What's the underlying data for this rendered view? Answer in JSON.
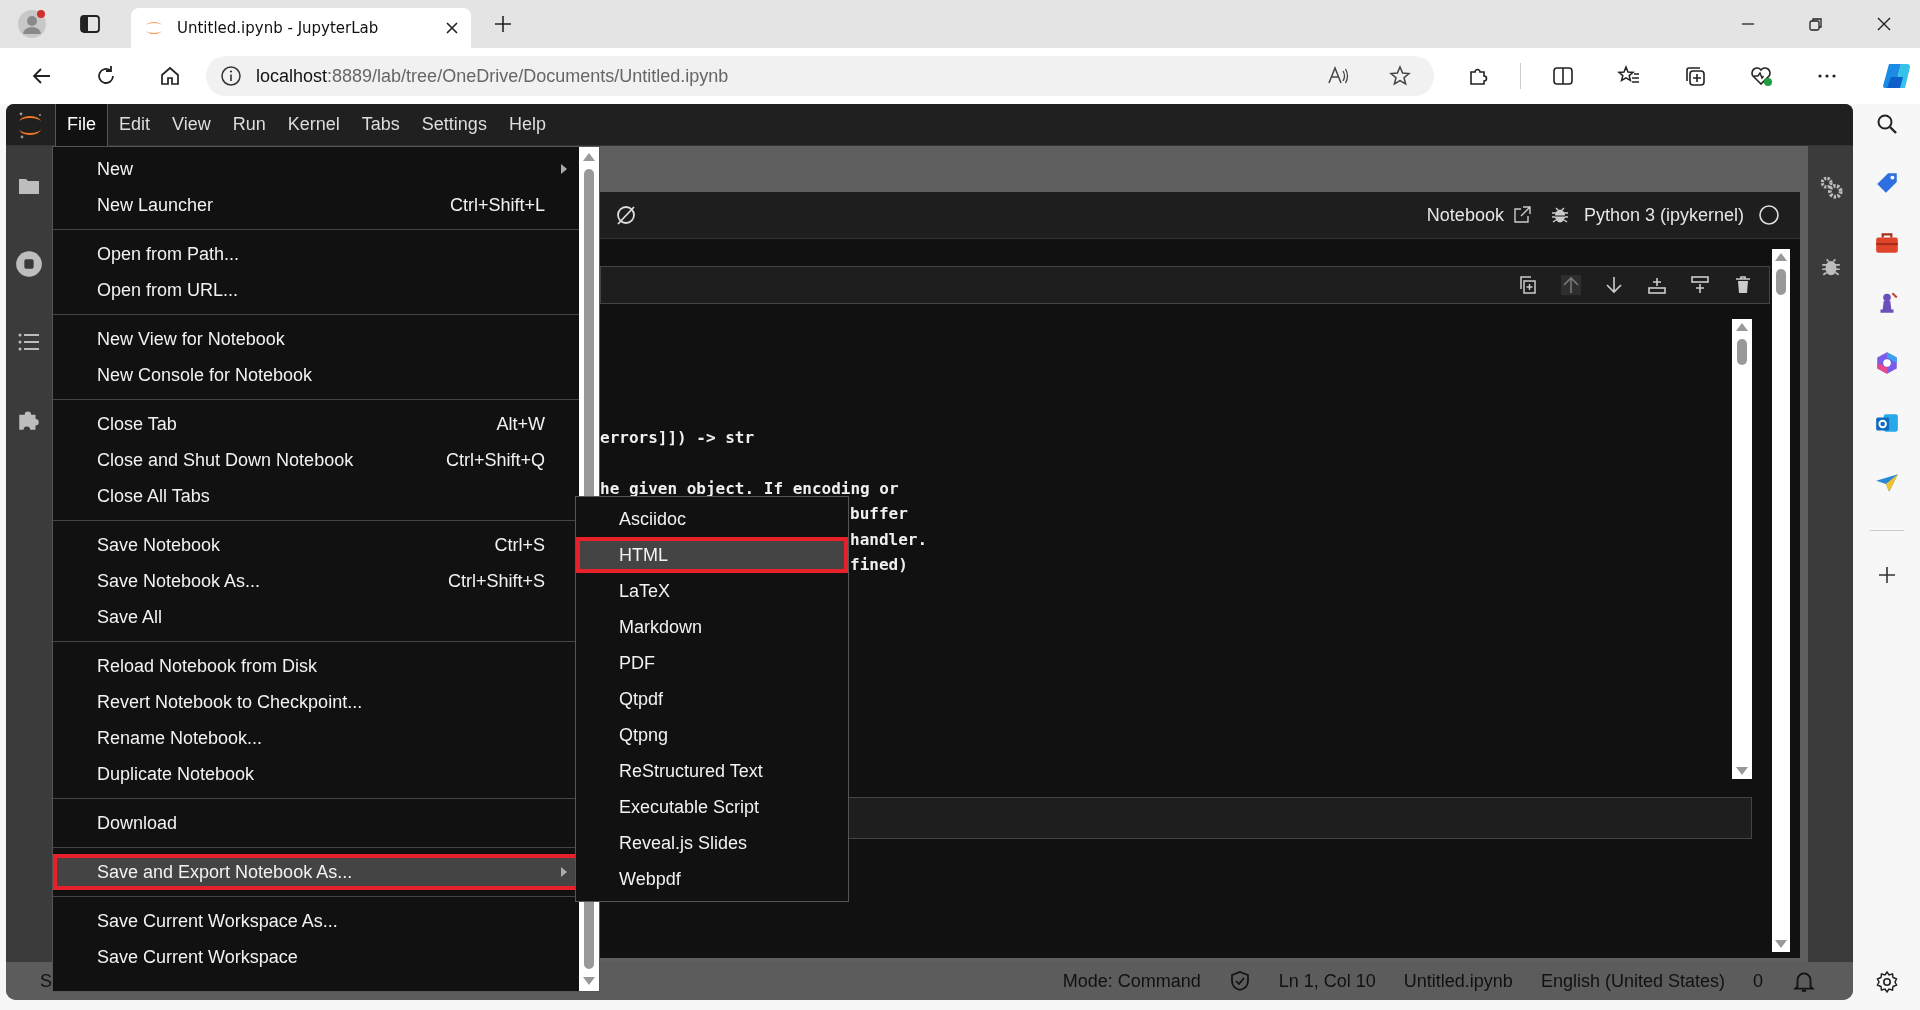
{
  "browser": {
    "tab_title": "Untitled.ipynb - JupyterLab",
    "url_host": "localhost",
    "url_rest": ":8889/lab/tree/OneDrive/Documents/Untitled.ipynb"
  },
  "menubar": [
    {
      "label": "File",
      "selected": true
    },
    {
      "label": "Edit",
      "selected": false
    },
    {
      "label": "View",
      "selected": false
    },
    {
      "label": "Run",
      "selected": false
    },
    {
      "label": "Kernel",
      "selected": false
    },
    {
      "label": "Tabs",
      "selected": false
    },
    {
      "label": "Settings",
      "selected": false
    },
    {
      "label": "Help",
      "selected": false
    }
  ],
  "file_menu": [
    [
      {
        "label": "New",
        "has_submenu": true,
        "selected": false
      },
      {
        "label": "New Launcher",
        "shortcut": "Ctrl+Shift+L",
        "has_submenu": false,
        "selected": false
      }
    ],
    [
      {
        "label": "Open from Path...",
        "has_submenu": false,
        "selected": false
      },
      {
        "label": "Open from URL...",
        "has_submenu": false,
        "selected": false
      }
    ],
    [
      {
        "label": "New View for Notebook",
        "has_submenu": false,
        "selected": false
      },
      {
        "label": "New Console for Notebook",
        "has_submenu": false,
        "selected": false
      }
    ],
    [
      {
        "label": "Close Tab",
        "shortcut": "Alt+W",
        "has_submenu": false,
        "selected": false
      },
      {
        "label": "Close and Shut Down Notebook",
        "shortcut": "Ctrl+Shift+Q",
        "has_submenu": false,
        "selected": false
      },
      {
        "label": "Close All Tabs",
        "has_submenu": false,
        "selected": false
      }
    ],
    [
      {
        "label": "Save Notebook",
        "shortcut": "Ctrl+S",
        "has_submenu": false,
        "selected": false
      },
      {
        "label": "Save Notebook As...",
        "shortcut": "Ctrl+Shift+S",
        "has_submenu": false,
        "selected": false
      },
      {
        "label": "Save All",
        "has_submenu": false,
        "selected": false
      }
    ],
    [
      {
        "label": "Reload Notebook from Disk",
        "has_submenu": false,
        "selected": false
      },
      {
        "label": "Revert Notebook to Checkpoint...",
        "has_submenu": false,
        "selected": false
      },
      {
        "label": "Rename Notebook...",
        "has_submenu": false,
        "selected": false
      },
      {
        "label": "Duplicate Notebook",
        "has_submenu": false,
        "selected": false
      }
    ],
    [
      {
        "label": "Download",
        "has_submenu": false,
        "selected": false
      }
    ],
    [
      {
        "label": "Save and Export Notebook As...",
        "has_submenu": true,
        "selected": true
      }
    ],
    [
      {
        "label": "Save Current Workspace As...",
        "has_submenu": false,
        "selected": false
      },
      {
        "label": "Save Current Workspace",
        "has_submenu": false,
        "selected": false
      }
    ]
  ],
  "export_submenu": [
    {
      "label": "Asciidoc",
      "selected": false
    },
    {
      "label": "HTML",
      "selected": true
    },
    {
      "label": "LaTeX",
      "selected": false
    },
    {
      "label": "Markdown",
      "selected": false
    },
    {
      "label": "PDF",
      "selected": false
    },
    {
      "label": "Qtpdf",
      "selected": false
    },
    {
      "label": "Qtpng",
      "selected": false
    },
    {
      "label": "ReStructured Text",
      "selected": false
    },
    {
      "label": "Executable Script",
      "selected": false
    },
    {
      "label": "Reveal.js Slides",
      "selected": false
    },
    {
      "label": "Webpdf",
      "selected": false
    }
  ],
  "notebook_toolbar": {
    "mode_label": "Notebook",
    "kernel": "Python 3 (ipykernel)"
  },
  "output": {
    "lines": [
      "errors]]) -> str",
      "he given object. If encoding or"
    ],
    "lines_beside_menu": [
      "buffer",
      "handler.",
      "fined)"
    ]
  },
  "status_bar": {
    "left_partial": "S",
    "mode": "Mode: Command",
    "position": "Ln 1, Col 10",
    "file": "Untitled.ipynb",
    "language": "English (United States)",
    "notifications": "0"
  }
}
